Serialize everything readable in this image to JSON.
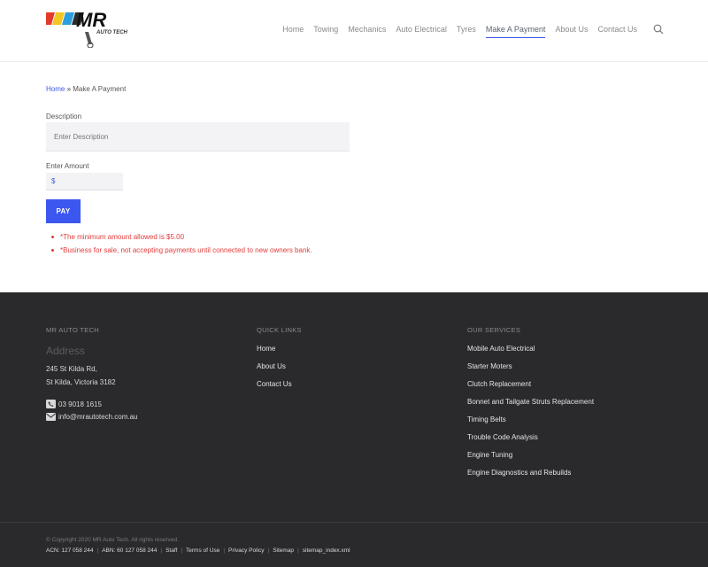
{
  "header": {
    "logo_text": "MR",
    "logo_subtext": "AUTO TECH",
    "nav": [
      "Home",
      "Towing",
      "Mechanics",
      "Auto Electrical",
      "Tyres",
      "Make A Payment",
      "About Us",
      "Contact Us"
    ],
    "active_nav": "Make A Payment",
    "accent_color": "#3c56f0"
  },
  "breadcrumb": {
    "home": "Home",
    "separator": "»",
    "current": "Make A Payment"
  },
  "form": {
    "description_label": "Description",
    "description_placeholder": "Enter Description",
    "amount_label": "Enter Amount",
    "amount_value": "$",
    "pay_label": "PAY",
    "notes": [
      "*The minimum amount allowed is $5.00",
      "*Business for sale, not accepting payments until connected to new owners bank."
    ]
  },
  "footer": {
    "col1": {
      "heading": "MR AUTO TECH",
      "address_heading": "Address",
      "address_line1": "245 St Kilda Rd,",
      "address_line2": "St Kilda, Victoria 3182",
      "phone": "03 9018 1615",
      "email": "info@mrautotech.com.au"
    },
    "col2": {
      "heading": "QUICK LINKS",
      "links": [
        "Home",
        "About Us",
        "Contact Us"
      ]
    },
    "col3": {
      "heading": "OUR SERVICES",
      "links": [
        "Mobile Auto Electrical",
        "Starter Moters",
        "Clutch Replacement",
        "Bonnet and Tailgate Struts Replacement",
        "Timing Belts",
        "Trouble Code Analysis",
        "Engine Tuning",
        "Engine Diagnostics and Rebuilds"
      ]
    }
  },
  "bottom": {
    "copyright": "© Copyright 2020 MR Auto Tech. All rights reserved.",
    "acn": "ACN: 127 058 244",
    "abn": "ABN: 60 127 058 244",
    "links": [
      "Staff",
      "Terms of Use",
      "Privacy Policy",
      "Sitemap",
      "sitemap_index.xml"
    ]
  }
}
